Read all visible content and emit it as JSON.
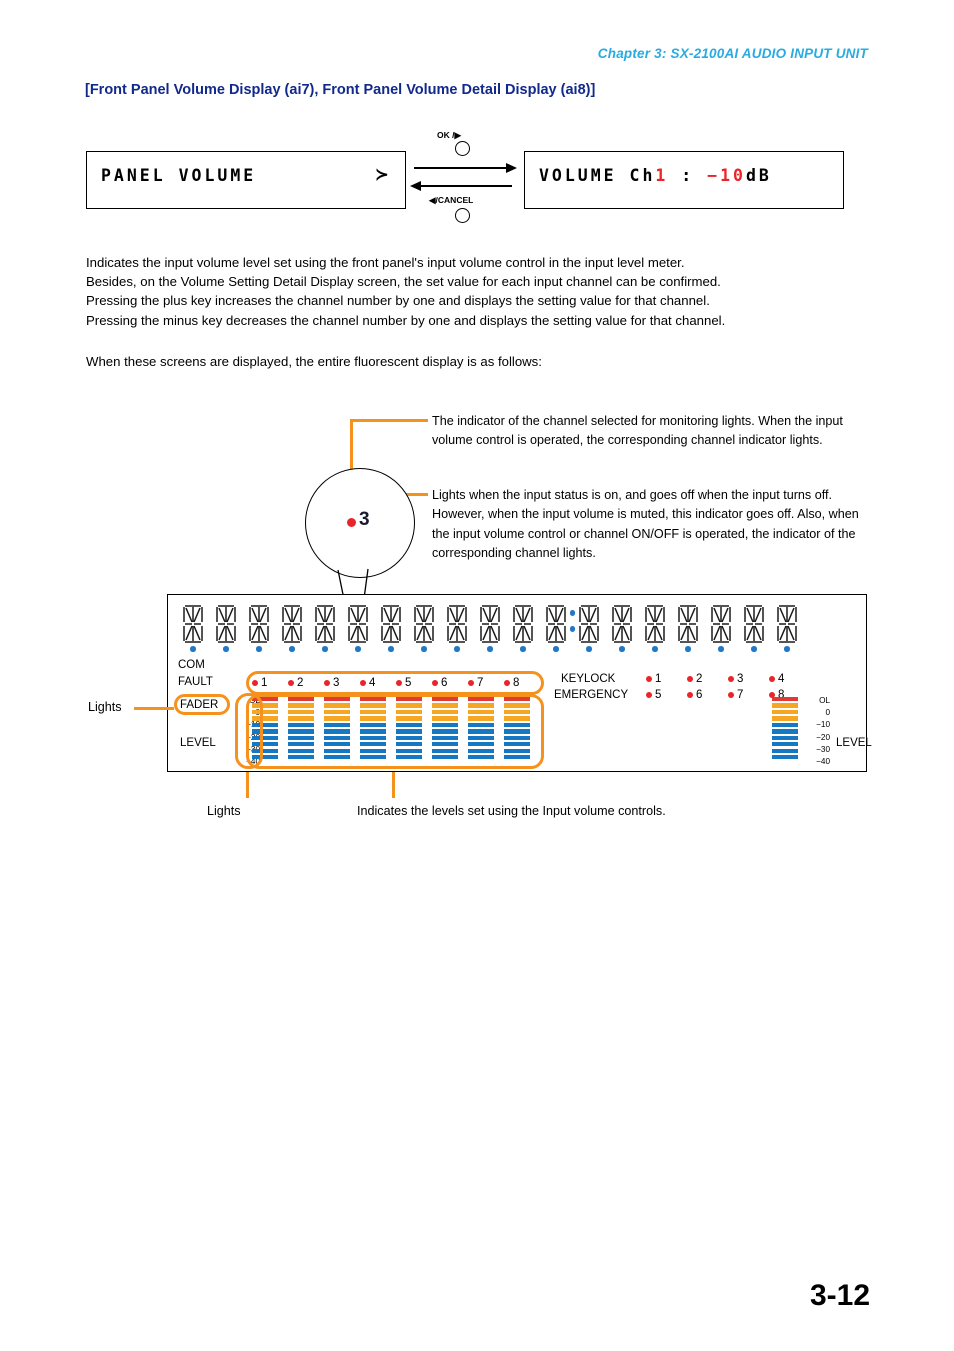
{
  "header": {
    "chapter": "Chapter 3:  SX-2100AI AUDIO INPUT UNIT",
    "section_title": "[Front Panel Volume Display (ai7), Front Panel Volume Detail Display (ai8)]",
    "accent_color": "#29ABE2",
    "title_color": "#12298C"
  },
  "transition": {
    "left_display": {
      "text": "PANEL  VOLUME",
      "arrow_glyph": "≻"
    },
    "right_display": {
      "prefix": "VOLUME Ch",
      "channel": "1",
      "separator": "  :  ",
      "value": "−10",
      "unit": "dB"
    },
    "forward_key_label": "OK /",
    "forward_key_glyph": "▶",
    "back_key_glyph": "◀",
    "back_key_label": "/CANCEL"
  },
  "body": {
    "paragraph_lines": [
      "Indicates the input volume level set using the front panel's input volume control in the input level meter.",
      "Besides, on the Volume Setting Detail Display screen, the set value for each input channel can be confirmed.",
      "Pressing the plus key increases the channel number by one and displays the setting value for that channel.",
      "Pressing the minus key decreases the channel number by one and displays the setting value for that channel."
    ],
    "sub_paragraph": "When these screens are displayed, the entire fluorescent display is as follows:"
  },
  "callouts": [
    {
      "id": "callout-1",
      "text": "The indicator of the channel selected for monitoring lights. When the input volume control is operated, the corresponding channel indicator lights."
    },
    {
      "id": "callout-2",
      "text": "Lights when the input status is on, and goes off when the input turns off. However, when the input volume is muted, this indicator goes off. Also, when the input volume control or channel ON/OFF is operated, the indicator of the corresponding channel lights."
    }
  ],
  "magnifier": {
    "channel_number": "3",
    "lamp_color": "#E8252A"
  },
  "panel": {
    "segment_display": {
      "character_count": 19,
      "colon_after_index": 11,
      "underline_dot_color": "#2277C8"
    },
    "status_labels": {
      "com": "COM",
      "fault": "FAULT",
      "fader": "FADER",
      "level": "LEVEL",
      "keylock": "KEYLOCK",
      "emergency": "EMERGENCY",
      "master_level": "LEVEL"
    },
    "channel_indicators": [
      "1",
      "2",
      "3",
      "4",
      "5",
      "6",
      "7",
      "8"
    ],
    "lamp_grid": [
      [
        "1",
        "2",
        "3",
        "4"
      ],
      [
        "5",
        "6",
        "7",
        "8"
      ]
    ],
    "db_scale": [
      "OL",
      "0",
      "−10",
      "−20",
      "−30",
      "−40"
    ],
    "master_db_scale": [
      "OL",
      "0",
      "−10",
      "−20",
      "−30",
      "−40"
    ],
    "meter_segments": [
      "r",
      "o",
      "o",
      "o",
      "b",
      "b",
      "b",
      "b",
      "b",
      "b"
    ],
    "meter_count": 8,
    "colors": {
      "overload": "#E03A32",
      "mid": "#F5A623",
      "low": "#1678C2",
      "highlight": "#F5921E",
      "lamp": "#E8252A"
    }
  },
  "annotations": {
    "lights_left": "Lights",
    "lights_bottom": "Lights",
    "levels_note": "Indicates the levels set using the Input volume controls."
  },
  "footer": {
    "page_number": "3-12"
  }
}
